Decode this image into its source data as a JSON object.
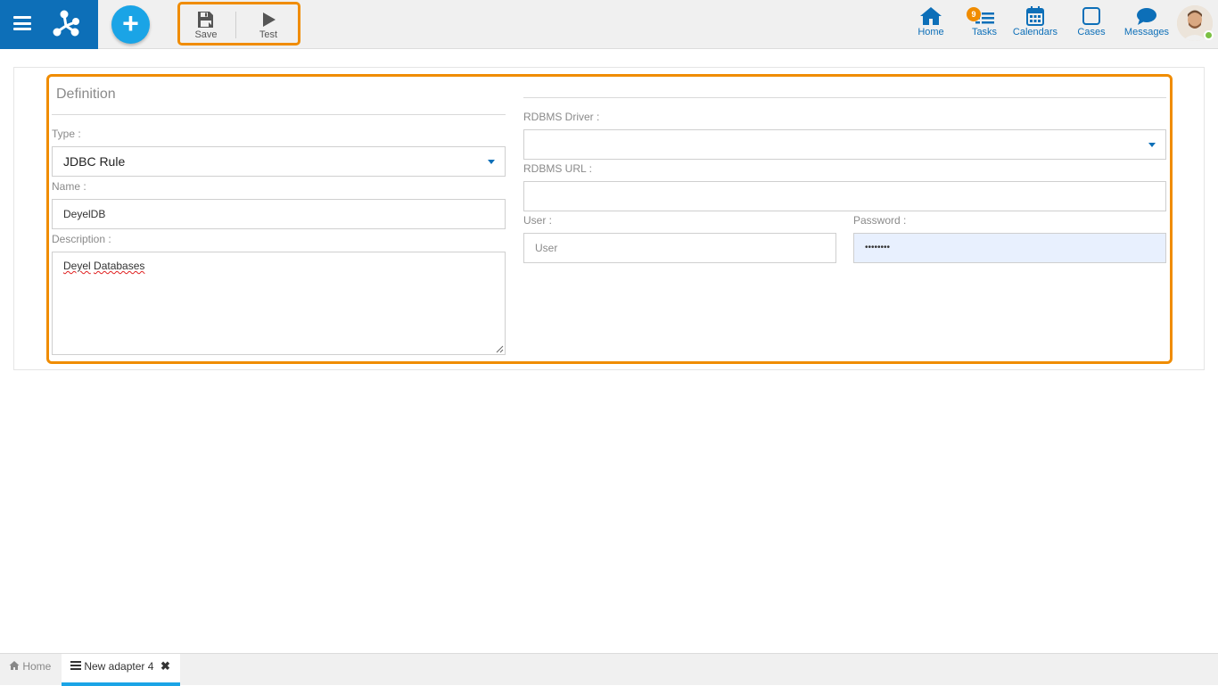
{
  "toolbar": {
    "save_label": "Save",
    "test_label": "Test"
  },
  "nav": {
    "home_label": "Home",
    "tasks_label": "Tasks",
    "tasks_badge": "9",
    "calendars_label": "Calendars",
    "cases_label": "Cases",
    "messages_label": "Messages"
  },
  "form": {
    "section_title": "Definition",
    "type_label": "Type :",
    "type_value": "JDBC Rule",
    "name_label": "Name :",
    "name_value": "DeyelDB",
    "description_label": "Description :",
    "description_value_part1": "Deyel",
    "description_value_part2": "Databases",
    "rdbms_driver_label": "RDBMS Driver :",
    "rdbms_driver_value": "",
    "rdbms_url_label": "RDBMS URL :",
    "rdbms_url_value": "",
    "user_label": "User :",
    "user_placeholder": "User",
    "password_label": "Password :",
    "password_value": "••••••••"
  },
  "tabs": {
    "home_label": "Home",
    "active_label": "New adapter 4",
    "close_glyph": "✖"
  },
  "colors": {
    "brand_blue": "#0d6fb8",
    "accent_orange": "#f08c00",
    "add_blue": "#1aa4e6"
  }
}
